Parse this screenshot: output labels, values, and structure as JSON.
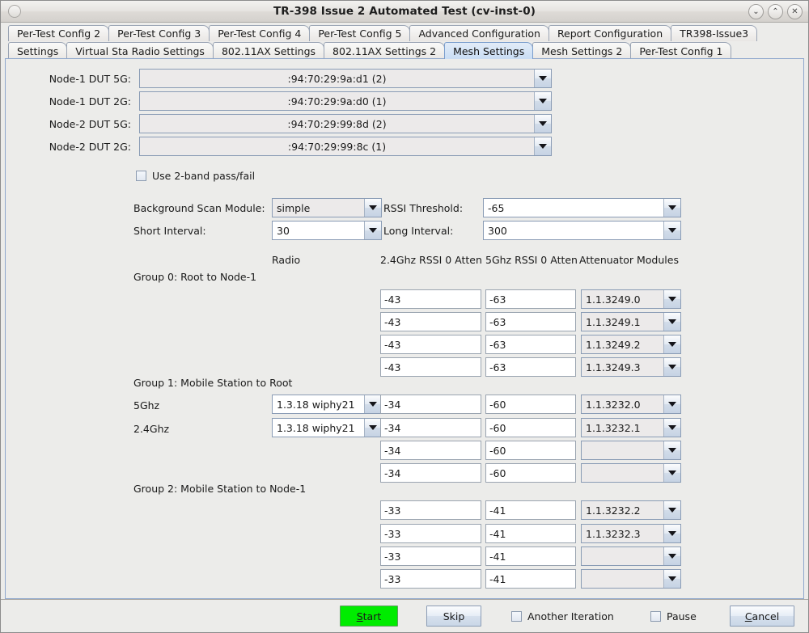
{
  "window": {
    "title": "TR-398 Issue 2 Automated Test  (cv-inst-0)",
    "menu_icon": "circle-icon",
    "buttons": [
      {
        "name": "minimize",
        "glyph": "⌄"
      },
      {
        "name": "maximize",
        "glyph": "⌃"
      },
      {
        "name": "close",
        "glyph": "✕"
      }
    ]
  },
  "tabs": {
    "row1": [
      {
        "label": "Per-Test Config 2",
        "active": false
      },
      {
        "label": "Per-Test Config 3",
        "active": false
      },
      {
        "label": "Per-Test Config 4",
        "active": false
      },
      {
        "label": "Per-Test Config 5",
        "active": false
      },
      {
        "label": "Advanced Configuration",
        "active": false
      },
      {
        "label": "Report Configuration",
        "active": false
      },
      {
        "label": "TR398-Issue3",
        "active": false
      }
    ],
    "row2": [
      {
        "label": "Settings",
        "active": false
      },
      {
        "label": "Virtual Sta Radio Settings",
        "active": false
      },
      {
        "label": "802.11AX Settings",
        "active": false
      },
      {
        "label": "802.11AX Settings 2",
        "active": false
      },
      {
        "label": "Mesh Settings",
        "active": true
      },
      {
        "label": "Mesh Settings 2",
        "active": false
      },
      {
        "label": "Per-Test Config 1",
        "active": false
      }
    ]
  },
  "nodes": [
    {
      "label": "Node-1 DUT 5G:",
      "value": ":94:70:29:9a:d1 (2)"
    },
    {
      "label": "Node-1 DUT 2G:",
      "value": ":94:70:29:9a:d0 (1)"
    },
    {
      "label": "Node-2 DUT 5G:",
      "value": ":94:70:29:99:8d (2)"
    },
    {
      "label": "Node-2 DUT 2G:",
      "value": ":94:70:29:99:8c (1)"
    }
  ],
  "two_band": {
    "label": "Use 2-band pass/fail",
    "checked": false
  },
  "scan": {
    "module_label": "Background Scan Module:",
    "module_value": "simple",
    "rssi_label": "RSSI Threshold:",
    "rssi_value": "-65",
    "short_label": "Short Interval:",
    "short_value": "30",
    "long_label": "Long Interval:",
    "long_value": "300"
  },
  "columns": {
    "radio": "Radio",
    "rssi24": "2.4Ghz RSSI 0 Atten",
    "rssi5": "5Ghz RSSI 0 Atten",
    "atten": "Attenuator Modules"
  },
  "groups": [
    {
      "title": "Group 0: Root to Node-1",
      "rows": [
        {
          "row_label": "",
          "radio": "",
          "rssi24": "-43",
          "rssi5": "-63",
          "atten": "1.1.3249.0"
        },
        {
          "row_label": "",
          "radio": "",
          "rssi24": "-43",
          "rssi5": "-63",
          "atten": "1.1.3249.1"
        },
        {
          "row_label": "",
          "radio": "",
          "rssi24": "-43",
          "rssi5": "-63",
          "atten": "1.1.3249.2"
        },
        {
          "row_label": "",
          "radio": "",
          "rssi24": "-43",
          "rssi5": "-63",
          "atten": "1.1.3249.3"
        }
      ]
    },
    {
      "title": "Group 1: Mobile Station to Root",
      "rows": [
        {
          "row_label": "5Ghz",
          "radio": "1.3.18 wiphy21",
          "rssi24": "-34",
          "rssi5": "-60",
          "atten": "1.1.3232.0"
        },
        {
          "row_label": "2.4Ghz",
          "radio": "1.3.18 wiphy21",
          "rssi24": "-34",
          "rssi5": "-60",
          "atten": "1.1.3232.1"
        },
        {
          "row_label": "",
          "radio": "",
          "rssi24": "-34",
          "rssi5": "-60",
          "atten": ""
        },
        {
          "row_label": "",
          "radio": "",
          "rssi24": "-34",
          "rssi5": "-60",
          "atten": ""
        }
      ]
    },
    {
      "title": "Group 2: Mobile Station to Node-1",
      "rows": [
        {
          "row_label": "",
          "radio": "",
          "rssi24": "-33",
          "rssi5": "-41",
          "atten": "1.1.3232.2"
        },
        {
          "row_label": "",
          "radio": "",
          "rssi24": "-33",
          "rssi5": "-41",
          "atten": "1.1.3232.3"
        },
        {
          "row_label": "",
          "radio": "",
          "rssi24": "-33",
          "rssi5": "-41",
          "atten": ""
        },
        {
          "row_label": "",
          "radio": "",
          "rssi24": "-33",
          "rssi5": "-41",
          "atten": ""
        }
      ]
    }
  ],
  "footer": {
    "start": "Start",
    "start_mnemonic": "S",
    "start_rest": "tart",
    "start_color": "#00ec00",
    "skip": "Skip",
    "another_iteration": "Another Iteration",
    "another_iteration_checked": false,
    "pause": "Pause",
    "pause_checked": false,
    "cancel_mnemonic": "C",
    "cancel_rest": "ancel"
  }
}
